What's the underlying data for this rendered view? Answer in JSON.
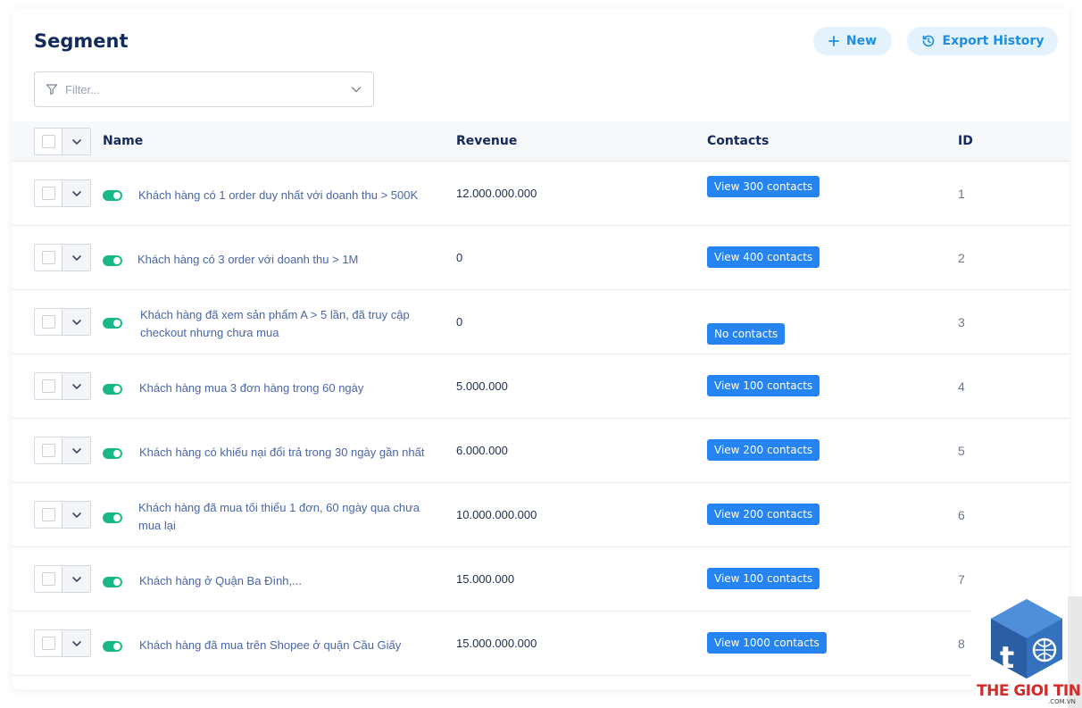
{
  "header": {
    "title": "Segment",
    "new_label": "New",
    "export_label": "Export History"
  },
  "filter": {
    "placeholder": "Filter..."
  },
  "table": {
    "columns": {
      "name": "Name",
      "revenue": "Revenue",
      "contacts": "Contacts",
      "id": "ID"
    },
    "rows": [
      {
        "name": "Khách hàng có 1 order duy nhất với doanh thu > 500K",
        "revenue": "12.000.000.000",
        "contacts": "View 300 contacts",
        "id": "1"
      },
      {
        "name": "Khách hàng có 3 order với doanh thu > 1M",
        "revenue": "0",
        "contacts": "View 400 contacts",
        "id": "2"
      },
      {
        "name": "Khách hàng đã xem sản phẩm A > 5 lần, đã truy cập checkout nhưng chưa mua",
        "revenue": "0",
        "contacts": "No contacts",
        "id": "3"
      },
      {
        "name": "Khách hàng mua 3 đơn hàng trong 60 ngày",
        "revenue": "5.000.000",
        "contacts": "View 100 contacts",
        "id": "4"
      },
      {
        "name": "Khách hàng có khiếu nại đổi trả trong 30 ngày gần nhất",
        "revenue": "6.000.000",
        "contacts": "View 200 contacts",
        "id": "5"
      },
      {
        "name": "Khách hàng đã mua tối thiểu 1 đơn, 60 ngày qua chưa mua lại",
        "revenue": "10.000.000.000",
        "contacts": "View 200 contacts",
        "id": "6"
      },
      {
        "name": "Khách hàng ở Quận Ba Đình,...",
        "revenue": "15.000.000",
        "contacts": "View 100 contacts",
        "id": "7"
      },
      {
        "name": "Khách hàng đã mua trên Shopee ở quận Cầu Giấy",
        "revenue": "15.000.000.000",
        "contacts": "View 1000 contacts",
        "id": "8"
      }
    ]
  },
  "watermark": {
    "text": "THE GIOI TINHOC",
    "sub": ".COM.VN"
  },
  "colors": {
    "accent": "#1d8fe3",
    "button_bg": "#e4f2fd",
    "toggle_on": "#19b888",
    "contacts_badge": "#2584f0",
    "title": "#142a5c"
  },
  "icons": {
    "new": "plus-icon",
    "export": "history-icon",
    "filter": "filter-icon",
    "dropdown": "chevron-down-icon"
  }
}
